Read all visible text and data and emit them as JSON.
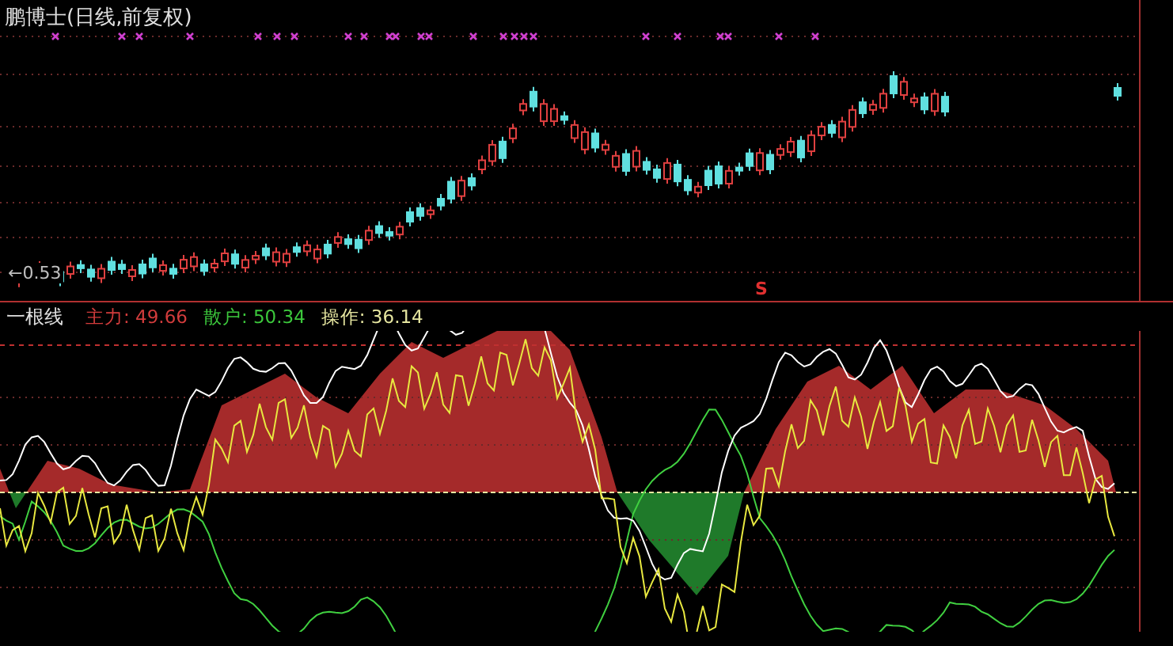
{
  "chart_title": "鹏博士(日线,前复权)",
  "price_marker": "←0.53",
  "signal": "S",
  "indicator": {
    "name": "一根线",
    "readings": [
      {
        "label": "主力:",
        "value": "49.66",
        "color": "#d23c3c"
      },
      {
        "label": "散户:",
        "value": "50.34",
        "color": "#3cc83c"
      },
      {
        "label": "操作:",
        "value": "36.14",
        "color": "#e6e6a0"
      }
    ]
  }
}
